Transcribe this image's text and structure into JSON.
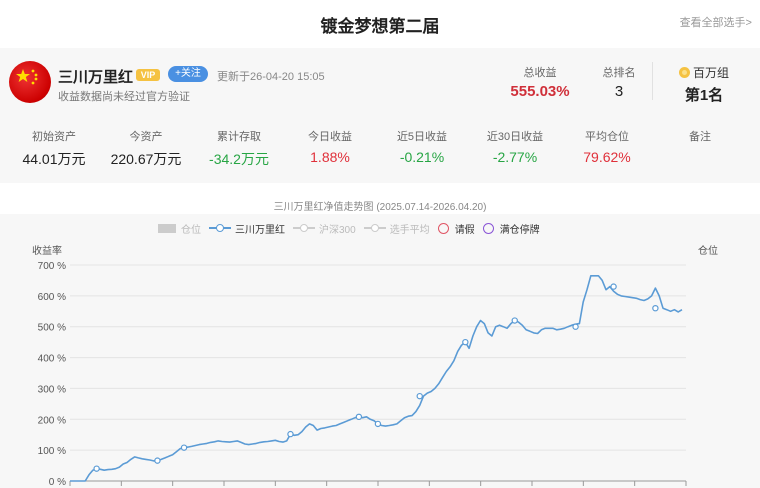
{
  "header": {
    "title": "镀金梦想第二届",
    "view_all": "查看全部选手>"
  },
  "profile": {
    "name": "三川万里红",
    "vip": "VIP",
    "follow": "+关注",
    "updated": "更新于26-04-20 15:05",
    "note": "收益数据尚未经过官方验证",
    "total_profit_label": "总收益",
    "total_profit": "555.03%",
    "rank_label": "总排名",
    "rank": "3",
    "group_label": "百万组",
    "group_rank": "第1名"
  },
  "metrics": [
    {
      "label": "初始资产",
      "value": "44.01万元",
      "color": "dark"
    },
    {
      "label": "今资产",
      "value": "220.67万元",
      "color": "dark"
    },
    {
      "label": "累计存取",
      "value": "-34.2万元",
      "color": "green"
    },
    {
      "label": "今日收益",
      "value": "1.88%",
      "color": "red"
    },
    {
      "label": "近5日收益",
      "value": "-0.21%",
      "color": "green"
    },
    {
      "label": "近30日收益",
      "value": "-2.77%",
      "color": "green"
    },
    {
      "label": "平均仓位",
      "value": "79.62%",
      "color": "red"
    },
    {
      "label": "备注",
      "value": "",
      "color": "dark"
    }
  ],
  "chart_data": {
    "type": "line",
    "title": "三川万里红净值走势图 (2025.07.14-2026.04.20)",
    "ylabel": "收益率",
    "y2label": "仓位",
    "ylim": [
      0,
      700
    ],
    "yticks": [
      "0 %",
      "100 %",
      "200 %",
      "300 %",
      "400 %",
      "500 %",
      "600 %",
      "700 %"
    ],
    "grid": true,
    "legend_position": "top-center",
    "legend": [
      {
        "name": "仓位",
        "kind": "rect",
        "color": "#cccccc",
        "active": false
      },
      {
        "name": "三川万里红",
        "kind": "line",
        "color": "#5b9bd5",
        "active": true
      },
      {
        "name": "沪深300",
        "kind": "line",
        "color": "#cccccc",
        "active": false
      },
      {
        "name": "选手平均",
        "kind": "line",
        "color": "#cccccc",
        "active": false
      },
      {
        "name": "请假",
        "kind": "circle",
        "color": "#e05565",
        "active": true
      },
      {
        "name": "满仓停牌",
        "kind": "circle",
        "color": "#8a55d6",
        "active": true
      }
    ],
    "series": [
      {
        "name": "三川万里红",
        "color": "#5b9bd5",
        "values": [
          0,
          0,
          0,
          0,
          0,
          20,
          35,
          40,
          38,
          35,
          37,
          38,
          40,
          45,
          55,
          60,
          70,
          78,
          75,
          72,
          70,
          68,
          65,
          66,
          70,
          75,
          80,
          85,
          95,
          105,
          108,
          110,
          112,
          115,
          118,
          120,
          122,
          125,
          127,
          130,
          128,
          127,
          126,
          128,
          130,
          125,
          120,
          118,
          120,
          122,
          125,
          127,
          128,
          130,
          132,
          128,
          126,
          130,
          152,
          148,
          150,
          160,
          175,
          185,
          180,
          165,
          170,
          172,
          175,
          178,
          180,
          185,
          190,
          195,
          200,
          205,
          208,
          205,
          208,
          200,
          195,
          185,
          180,
          178,
          180,
          182,
          185,
          195,
          205,
          210,
          212,
          225,
          245,
          275,
          285,
          290,
          300,
          315,
          335,
          355,
          370,
          390,
          420,
          440,
          450,
          430,
          470,
          500,
          520,
          510,
          480,
          470,
          500,
          505,
          500,
          495,
          510,
          520,
          515,
          505,
          490,
          485,
          480,
          478,
          490,
          495,
          495,
          495,
          490,
          492,
          495,
          500,
          505,
          508,
          510,
          580,
          620,
          665,
          665,
          665,
          650,
          620,
          630,
          615,
          605,
          600,
          598,
          596,
          594,
          592,
          588,
          585,
          590,
          600,
          625,
          600,
          560,
          555,
          550,
          555,
          548,
          555
        ]
      }
    ],
    "markers": [
      {
        "series": "三川万里红",
        "index": 7,
        "value": 40
      },
      {
        "series": "三川万里红",
        "index": 23,
        "value": 66
      },
      {
        "series": "三川万里红",
        "index": 30,
        "value": 108
      },
      {
        "series": "三川万里红",
        "index": 58,
        "value": 152
      },
      {
        "series": "三川万里红",
        "index": 76,
        "value": 208
      },
      {
        "series": "三川万里红",
        "index": 81,
        "value": 185
      },
      {
        "series": "三川万里红",
        "index": 92,
        "value": 275
      },
      {
        "series": "三川万里红",
        "index": 104,
        "value": 450
      },
      {
        "series": "三川万里红",
        "index": 117,
        "value": 520
      },
      {
        "series": "三川万里红",
        "index": 133,
        "value": 500
      },
      {
        "series": "三川万里红",
        "index": 143,
        "value": 630
      },
      {
        "series": "三川万里红",
        "index": 154,
        "value": 560
      }
    ]
  }
}
